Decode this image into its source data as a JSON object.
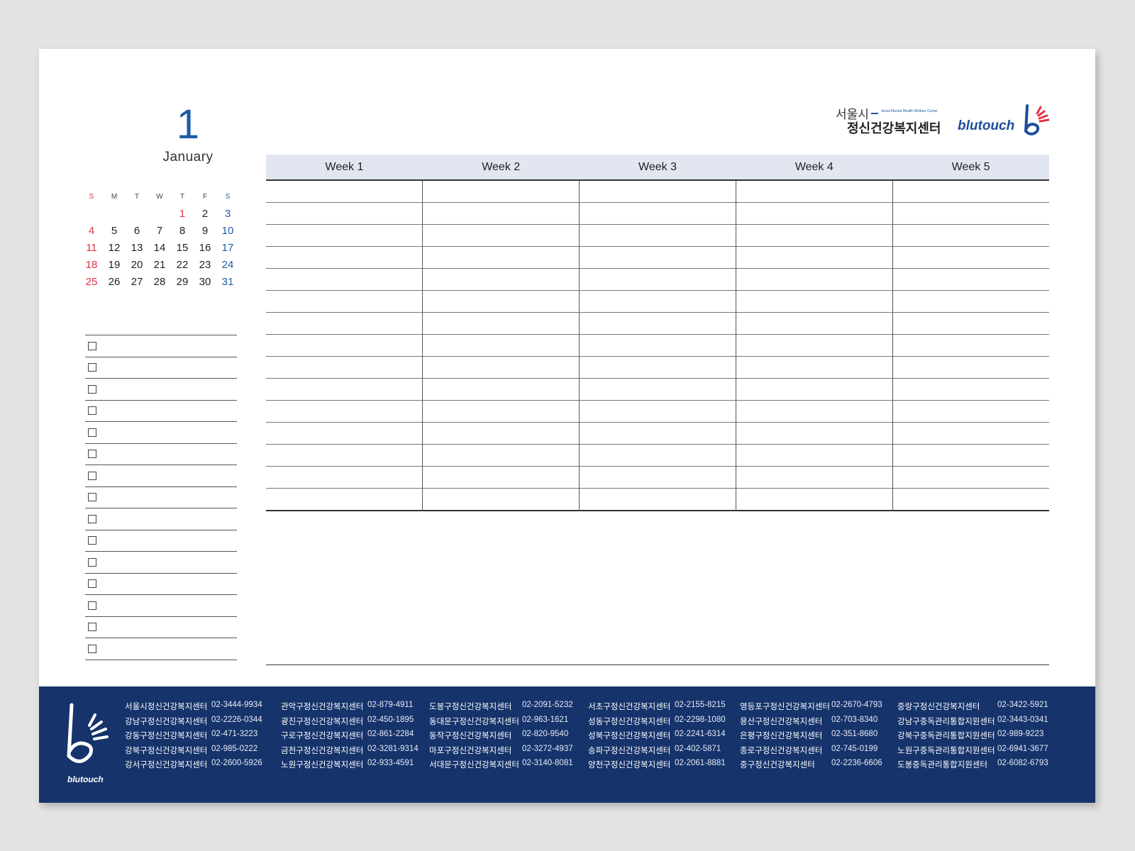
{
  "month": {
    "number": "1",
    "name": "January"
  },
  "mini_calendar": {
    "weekday_headers": [
      "S",
      "M",
      "T",
      "W",
      "T",
      "F",
      "S"
    ],
    "weeks": [
      [
        "",
        "",
        "",
        "",
        "1",
        "2",
        "3"
      ],
      [
        "4",
        "5",
        "6",
        "7",
        "8",
        "9",
        "10"
      ],
      [
        "11",
        "12",
        "13",
        "14",
        "15",
        "16",
        "17"
      ],
      [
        "18",
        "19",
        "20",
        "21",
        "22",
        "23",
        "24"
      ],
      [
        "25",
        "26",
        "27",
        "28",
        "29",
        "30",
        "31"
      ]
    ],
    "holiday_days": [
      "1"
    ],
    "colors": {
      "sunday": "#e0344a",
      "saturday": "#1d5aa6",
      "holiday": "#e0344a"
    }
  },
  "checklist": {
    "rows": 15
  },
  "weekly_grid": {
    "headers": [
      "Week 1",
      "Week 2",
      "Week 3",
      "Week 4",
      "Week 5"
    ],
    "lines_per_column": 16
  },
  "logos": {
    "seoul_top": "서울시",
    "seoul_main": "정신건강복지센터",
    "seoul_english": "Seoul Mental Health Welfare Center",
    "blutouch": "blutouch"
  },
  "footer": {
    "logo_text": "blutouch",
    "background_color": "#16336b",
    "directory": [
      [
        {
          "name": "서울시정신건강복지센터",
          "phone": "02-3444-9934"
        },
        {
          "name": "강남구정신건강복지센터",
          "phone": "02-2226-0344"
        },
        {
          "name": "강동구정신건강복지센터",
          "phone": "02-471-3223"
        },
        {
          "name": "강북구정신건강복지센터",
          "phone": "02-985-0222"
        },
        {
          "name": "강서구정신건강복지센터",
          "phone": "02-2600-5926"
        }
      ],
      [
        {
          "name": "관악구정신건강복지센터",
          "phone": "02-879-4911"
        },
        {
          "name": "광진구정신건강복지센터",
          "phone": "02-450-1895"
        },
        {
          "name": "구로구정신건강복지센터",
          "phone": "02-861-2284"
        },
        {
          "name": "금천구정신건강복지센터",
          "phone": "02-3281-9314"
        },
        {
          "name": "노원구정신건강복지센터",
          "phone": "02-933-4591"
        }
      ],
      [
        {
          "name": "도봉구정신건강복지센터",
          "phone": "02-2091-5232"
        },
        {
          "name": "동대문구정신건강복지센터",
          "phone": "02-963-1621"
        },
        {
          "name": "동작구정신건강복지센터",
          "phone": "02-820-9540"
        },
        {
          "name": "마포구정신건강복지센터",
          "phone": "02-3272-4937"
        },
        {
          "name": "서대문구정신건강복지센터",
          "phone": "02-3140-8081"
        }
      ],
      [
        {
          "name": "서초구정신건강복지센터",
          "phone": "02-2155-8215"
        },
        {
          "name": "성동구정신건강복지센터",
          "phone": "02-2298-1080"
        },
        {
          "name": "성북구정신건강복지센터",
          "phone": "02-2241-6314"
        },
        {
          "name": "송파구정신건강복지센터",
          "phone": "02-402-5871"
        },
        {
          "name": "양천구정신건강복지센터",
          "phone": "02-2061-8881"
        }
      ],
      [
        {
          "name": "영등포구정신건강복지센터",
          "phone": "02-2670-4793"
        },
        {
          "name": "용산구정신건강복지센터",
          "phone": "02-703-8340"
        },
        {
          "name": "은평구정신건강복지센터",
          "phone": "02-351-8680"
        },
        {
          "name": "종로구정신건강복지센터",
          "phone": "02-745-0199"
        },
        {
          "name": "중구정신건강복지센터",
          "phone": "02-2236-6606"
        }
      ],
      [
        {
          "name": "중랑구정신건강복지센터",
          "phone": "02-3422-5921"
        },
        {
          "name": "강남구중독관리통합지원센터",
          "phone": "02-3443-0341"
        },
        {
          "name": "강북구중독관리통합지원센터",
          "phone": "02-989-9223"
        },
        {
          "name": "노원구중독관리통합지원센터",
          "phone": "02-6941-3677"
        },
        {
          "name": "도봉중독관리통합지원센터",
          "phone": "02-6082-6793"
        }
      ]
    ]
  }
}
